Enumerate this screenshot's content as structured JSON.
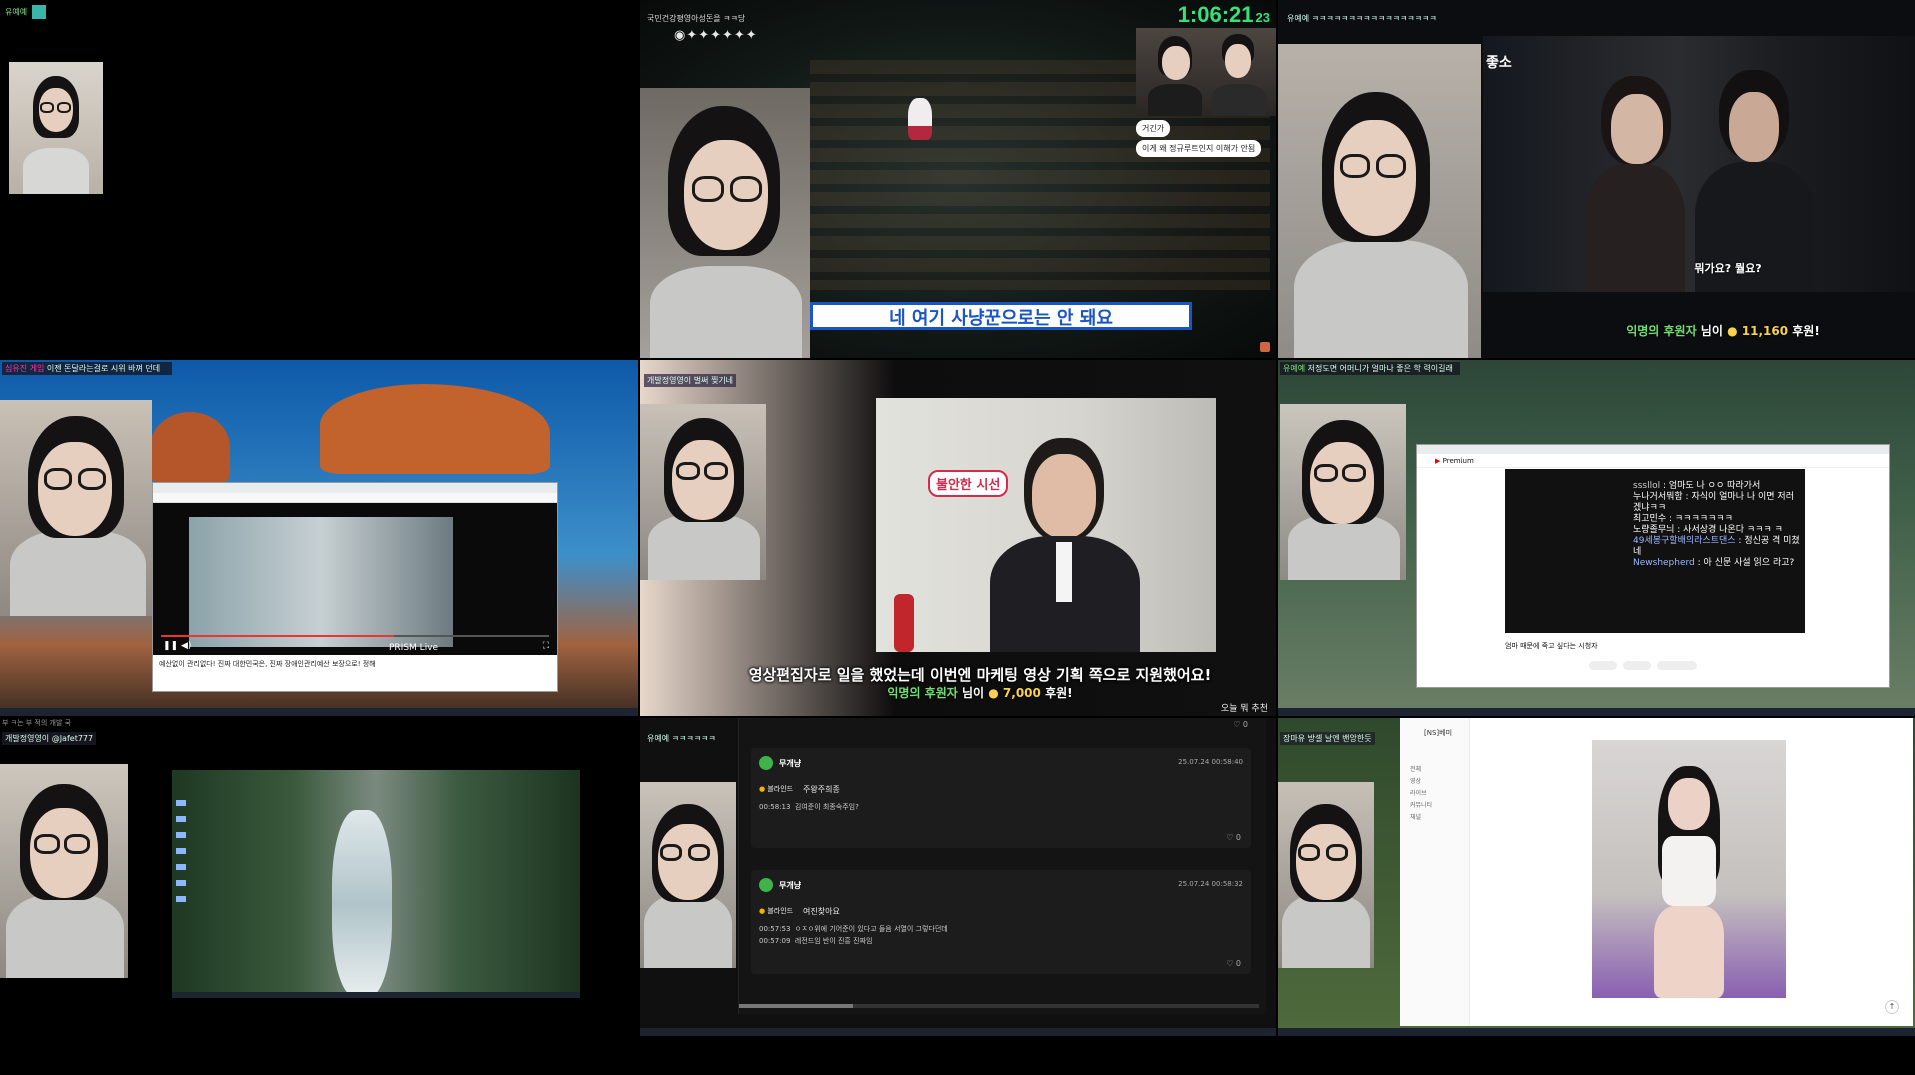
{
  "cells": {
    "c1": {
      "chat_name": "유예예",
      "tile_label": ""
    },
    "c2": {
      "timer": "1:06:21",
      "timer_small": "23",
      "top_chat": "국민건강평영아성돈을 ㅋㅋ당",
      "bubble1": "거긴가",
      "bubble2": "이게 왜 정규루트인지 이해가 안됨",
      "subtitle": "네 여기 사냥꾼으로는 안 돼요"
    },
    "c3": {
      "chat": "유예예 ㅋㅋㅋㅋㅋㅋㅋㅋㅋㅋㅋㅋㅋㅋㅋㅋㅋ",
      "subtitle": "뭐가요? 뭘요?",
      "donation_name": "익명의 후원자",
      "donation_suffix": "님이",
      "donation_amount": "11,160",
      "donation_unit": "후원!",
      "corner_text": "좋소"
    },
    "c4": {
      "chat_nick": "심유진 게임",
      "chat_msg": "이젠 돈달라는걸로 시위 바껴 던데",
      "player_label": "PRISM Live",
      "browser_caption": "예산없이 관리없다! 진짜 대한민국은, 진짜 장애인관리예산 보장으로! 정해"
    },
    "c5": {
      "chat": "개발정영영이 벌써 찢기네",
      "sign": "불안한 시선",
      "subtitle_pre": "영상편집자로 일을 했었는데 이번엔 ",
      "subtitle_bold": "마케팅 영상 기획",
      "subtitle_post": " 쪽으로 지원했어요!",
      "donation_name": "익명의 후원자",
      "donation_suffix": "님이",
      "donation_amount": "7,000",
      "donation_unit": "후원!",
      "bottom_right": "오늘 뭐 추천"
    },
    "c6": {
      "chat_nick": "유예예",
      "chat_msg": "저정도면 어머니가 얼마나 좋은 학 력이길래",
      "yt_brand": "Premium",
      "chats": [
        {
          "nick": "sssllol",
          "msg": "엄마도 나 ㅇㅇ 따라가서"
        },
        {
          "nick": "누나거서뭐함",
          "msg": "자식이 얼마나 나 이면 저러겠냐ㅋㅋ"
        },
        {
          "nick": "최고민수",
          "msg": "ㅋㅋㅋㅋㅋㅋㅋ"
        },
        {
          "nick": "노량졸무늬",
          "msg": "사서상경 나온다 ㅋㅋㅋ ㅋ"
        },
        {
          "nick": "49세봉구할배의라스트댄스",
          "msg": "정신공 격 미쳤네"
        },
        {
          "nick": "Newshepherd",
          "msg": "아 신문 사설 읽으 라고?"
        }
      ],
      "yt_title": "엄마 때문에 죽고 싶다는 시청자"
    },
    "c7": {
      "chat": "개발정영영이 @Jafet777",
      "top_text": "부 ㅋ는 부 적의 개발 국"
    },
    "c8": {
      "chat": "유예예 ㅋㅋㅋㅋㅋㅋ",
      "top_count": "0",
      "comments": [
        {
          "user": "무개냥",
          "date": "25.07.24",
          "time": "00:58:40",
          "tag": "블라인드",
          "title": "주왕주희종",
          "lines": [
            {
              "t": "00:58:13",
              "text": "김여준이 최종숙주임?"
            }
          ],
          "likes": "0"
        },
        {
          "user": "무개냥",
          "date": "25.07.24",
          "time": "00:58:32",
          "tag": "블라인드",
          "title": "여진찾아요",
          "lines": [
            {
              "t": "00:57:53",
              "text": "ㅇㅈㅇ위에 기어준이 있다고 들음 서열이 그렇다던데"
            },
            {
              "t": "00:57:09",
              "text": "레전드임 반이 진흥 진짜임"
            }
          ],
          "likes": "0"
        }
      ]
    },
    "c9": {
      "chat": "장마유 방셀 날엔 밴앙한듯",
      "sidebar_title": "[NS]베미",
      "sidebar_items": [
        "전체",
        "영상",
        "라이브",
        "커뮤니티",
        "채널"
      ]
    }
  }
}
